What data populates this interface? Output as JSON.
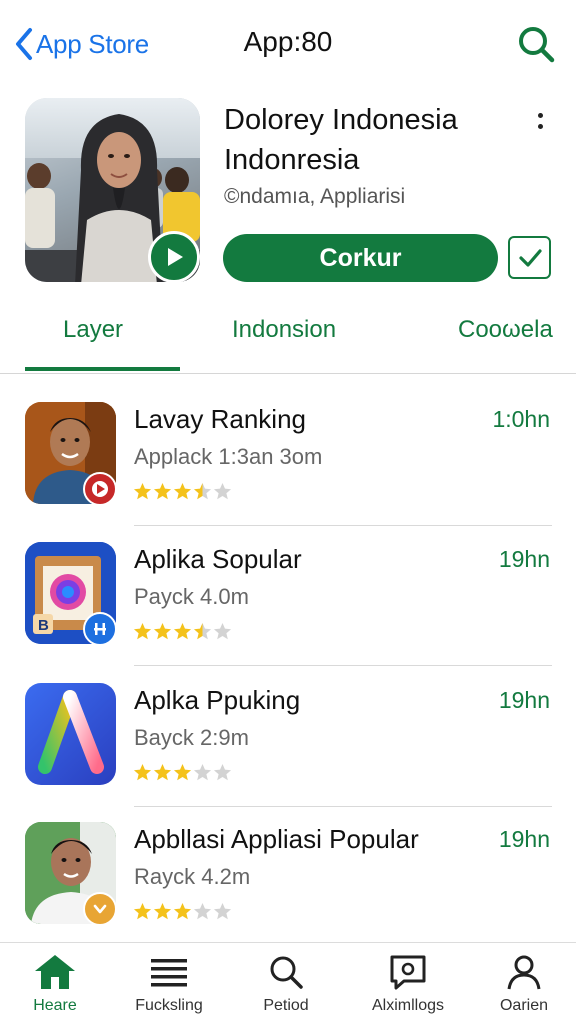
{
  "header": {
    "back_label": "App Store",
    "title": "App:80"
  },
  "app": {
    "title_line1": "Dolorey Indonesia",
    "title_line2": "Indonresia",
    "subtitle": "©ndamıa, Appliarisi",
    "primary_button": "Corkur"
  },
  "tabs": [
    {
      "label": "Layer",
      "active": true
    },
    {
      "label": "Indonsion",
      "active": false
    },
    {
      "label": "Cooωela",
      "active": false
    }
  ],
  "list": [
    {
      "name": "Lavay Ranking",
      "meta": "Applack 1:3an 3om",
      "time": "1:0hn",
      "rating": 3.5,
      "icon": "portrait-icon",
      "badge": "play-badge-icon"
    },
    {
      "name": "Aplika Sopular",
      "meta": "Payck 4.0m",
      "time": "19hn",
      "rating": 3.5,
      "icon": "frame-app-icon",
      "badge": "grid-badge-icon",
      "badge_letter": "B"
    },
    {
      "name": "Aplka Ppuking",
      "meta": "Bayck 2:9m",
      "time": "19hn",
      "rating": 3,
      "icon": "letter-a-app-icon"
    },
    {
      "name": "Apbllasi Appliasi Popular",
      "meta": "Rayck 4.2m",
      "time": "19hn",
      "rating": 3,
      "icon": "portrait-icon",
      "badge": "chevron-badge-icon"
    }
  ],
  "bottom_nav": [
    {
      "label": "Heare",
      "icon": "home-icon",
      "active": true
    },
    {
      "label": "Fucksling",
      "icon": "list-icon",
      "active": false
    },
    {
      "label": "Petiod",
      "icon": "search-icon",
      "active": false
    },
    {
      "label": "Alximllogs",
      "icon": "message-icon",
      "active": false
    },
    {
      "label": "Oarien",
      "icon": "person-icon",
      "active": false
    }
  ],
  "colors": {
    "accent": "#137a3f",
    "link": "#1a73e8",
    "star": "#f4c21b",
    "star_empty": "#d3d3d3"
  }
}
